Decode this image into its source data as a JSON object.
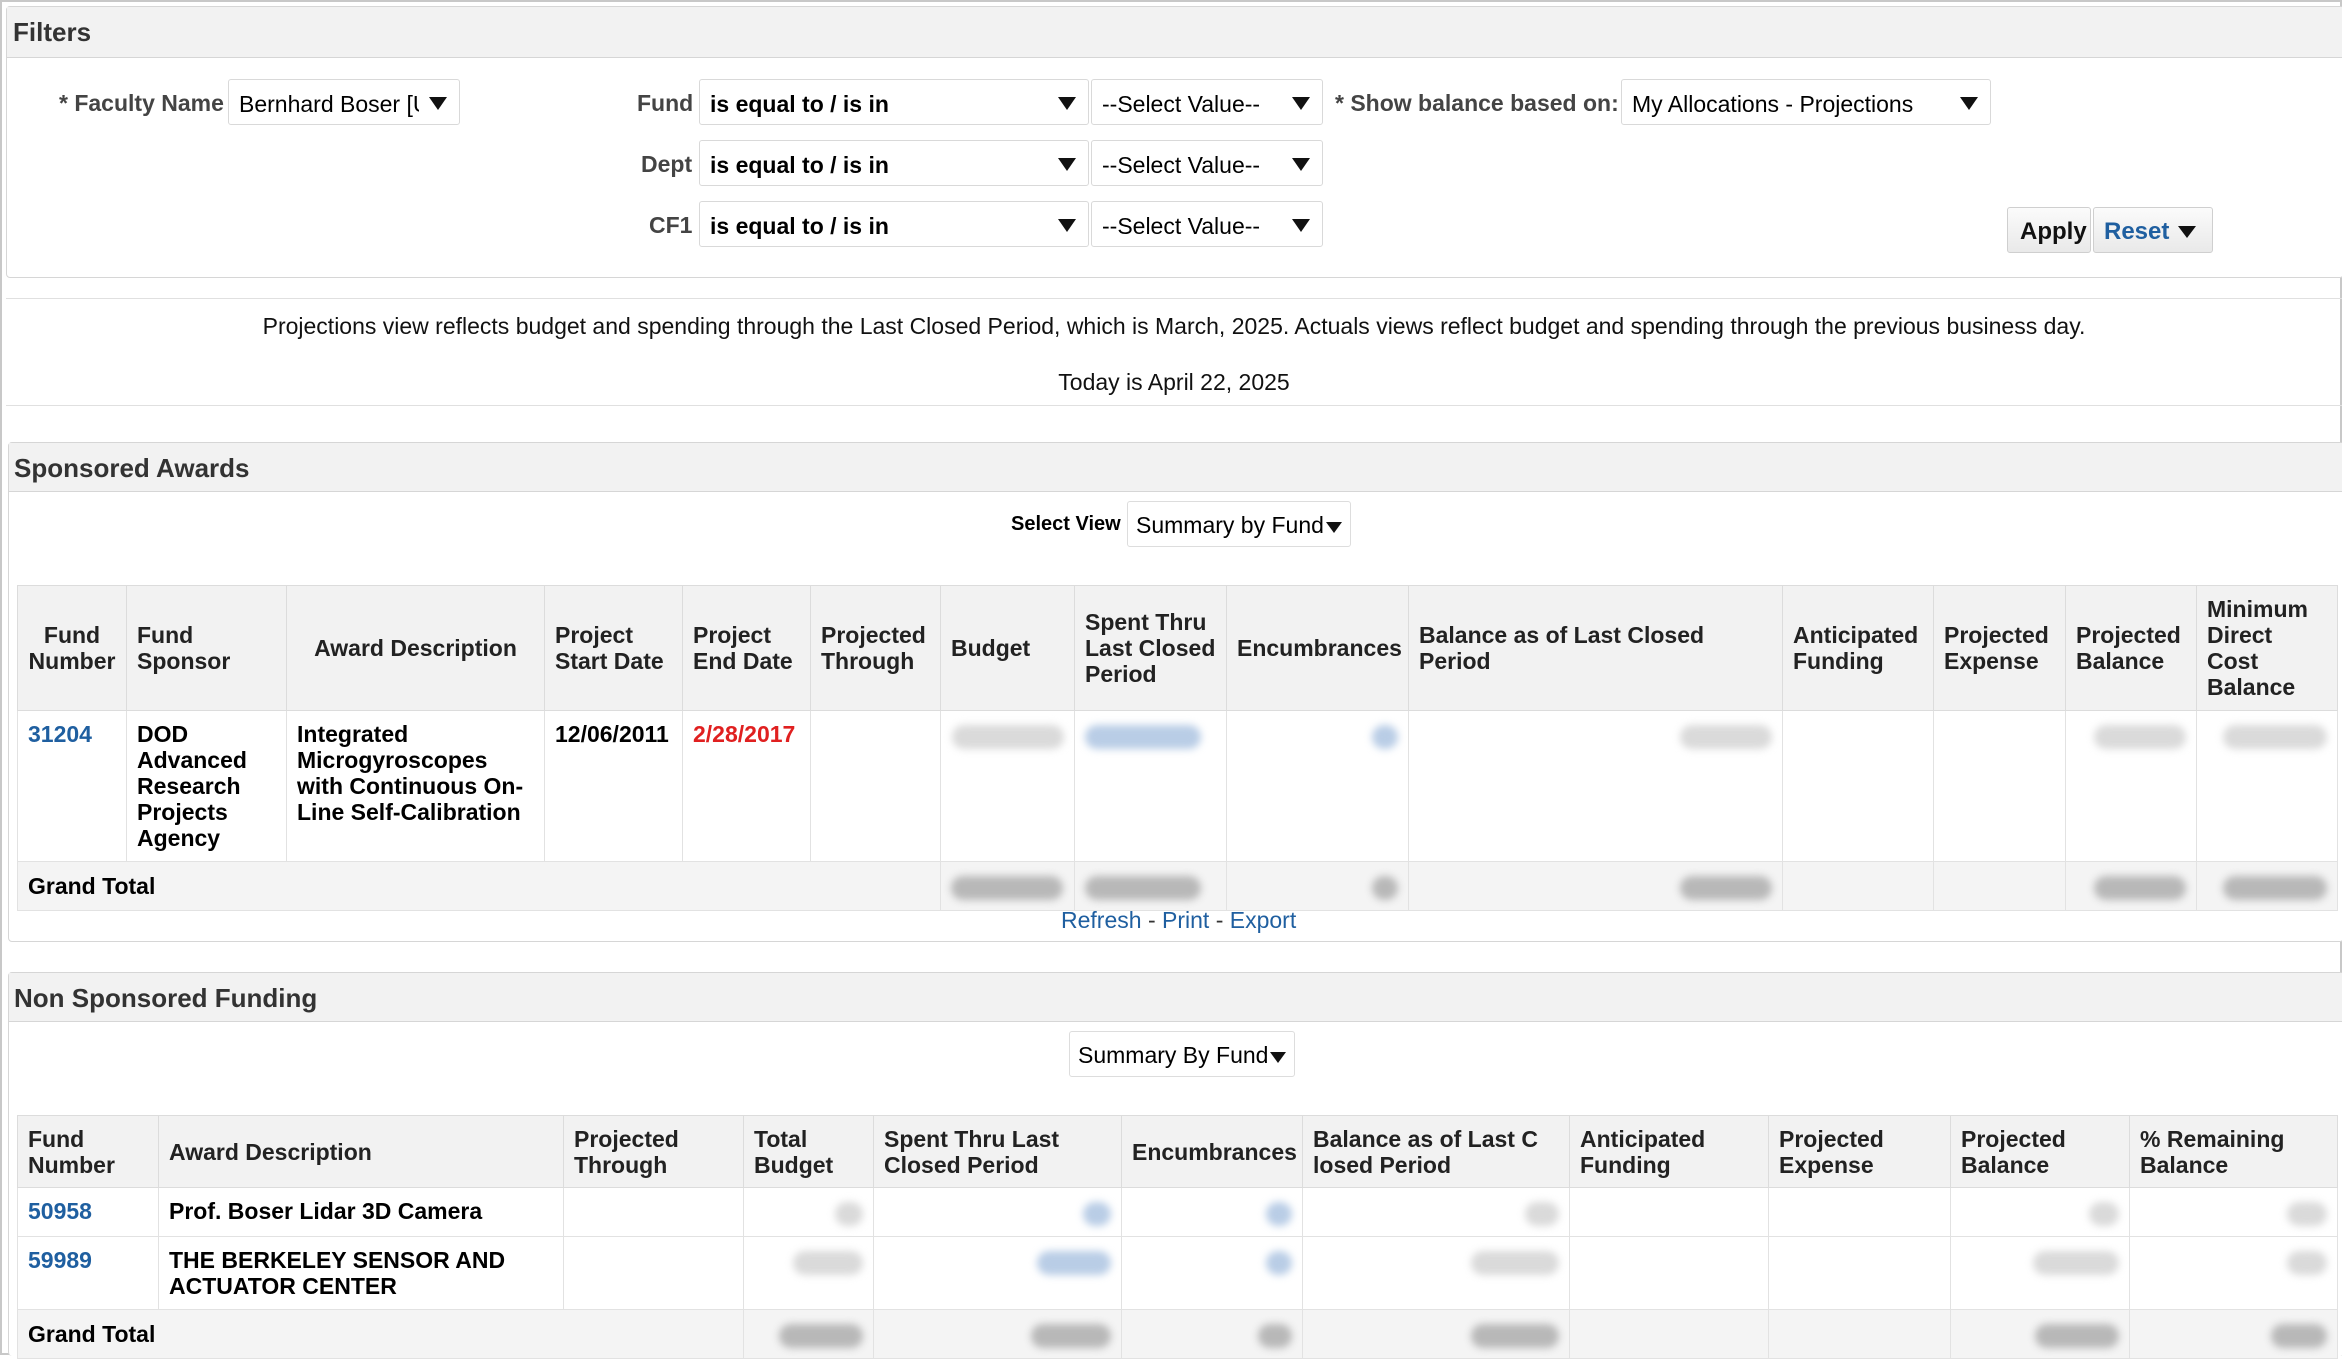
{
  "filters": {
    "title": "Filters",
    "faculty_label": "* Faculty Name",
    "faculty_value": "Bernhard Boser [U",
    "rows": [
      {
        "label": "Fund",
        "operator": "is equal to / is in",
        "value": "--Select Value--"
      },
      {
        "label": "Dept",
        "operator": "is equal to / is in",
        "value": "--Select Value--"
      },
      {
        "label": "CF1",
        "operator": "is equal to / is in",
        "value": "--Select Value--"
      }
    ],
    "balance_label": "* Show balance based on:",
    "balance_value": "My Allocations - Projections",
    "apply_label": "Apply",
    "reset_label": "Reset"
  },
  "info": {
    "line1": "Projections view reflects budget and spending through the Last Closed Period, which is March, 2025. Actuals views reflect budget and spending through the previous business day.",
    "line2": "Today is April 22, 2025"
  },
  "sponsored": {
    "title": "Sponsored Awards",
    "select_view_label": "Select View",
    "select_view_value": "Summary by Fund",
    "columns": [
      "Fund Number",
      "Fund Sponsor",
      "Award Description",
      "Project Start Date",
      "Project End Date",
      "Projected Through",
      "Budget",
      "Spent Thru Last Closed Period",
      "Encumbrances",
      "Balance as of Last Closed Period",
      "Anticipated Funding",
      "Projected Expense",
      "Projected Balance",
      "Minimum Direct Cost Balance"
    ],
    "rows": [
      {
        "fund_number": "31204",
        "sponsor": "DOD Advanced Research Projects Agency",
        "description": "Integrated Microgyroscopes with Continuous On-Line Self-Calibration",
        "start_date": "12/06/2011",
        "end_date": "2/28/2017",
        "projected_through": ""
      }
    ],
    "grand_total_label": "Grand Total",
    "links": [
      "Refresh",
      "Print",
      "Export"
    ]
  },
  "non_sponsored": {
    "title": "Non Sponsored Funding",
    "select_view_value": "Summary By Fund",
    "columns": [
      "Fund Number",
      "Award Description",
      "Projected Through",
      "Total Budget",
      "Spent Thru Last Closed Period",
      "Encumbrances",
      "Balance as of Last C losed Period",
      "Anticipated Funding",
      "Projected Expense",
      "Projected Balance",
      "% Remaining Balance"
    ],
    "rows": [
      {
        "fund_number": "50958",
        "description": "Prof. Boser Lidar 3D Camera"
      },
      {
        "fund_number": "59989",
        "description": "THE BERKELEY SENSOR AND ACTUATOR CENTER"
      }
    ],
    "grand_total_label": "Grand Total"
  },
  "colors": {
    "link": "#1f5fa0",
    "overdue_date": "#e02020",
    "header_bg": "#f2f2f2"
  }
}
